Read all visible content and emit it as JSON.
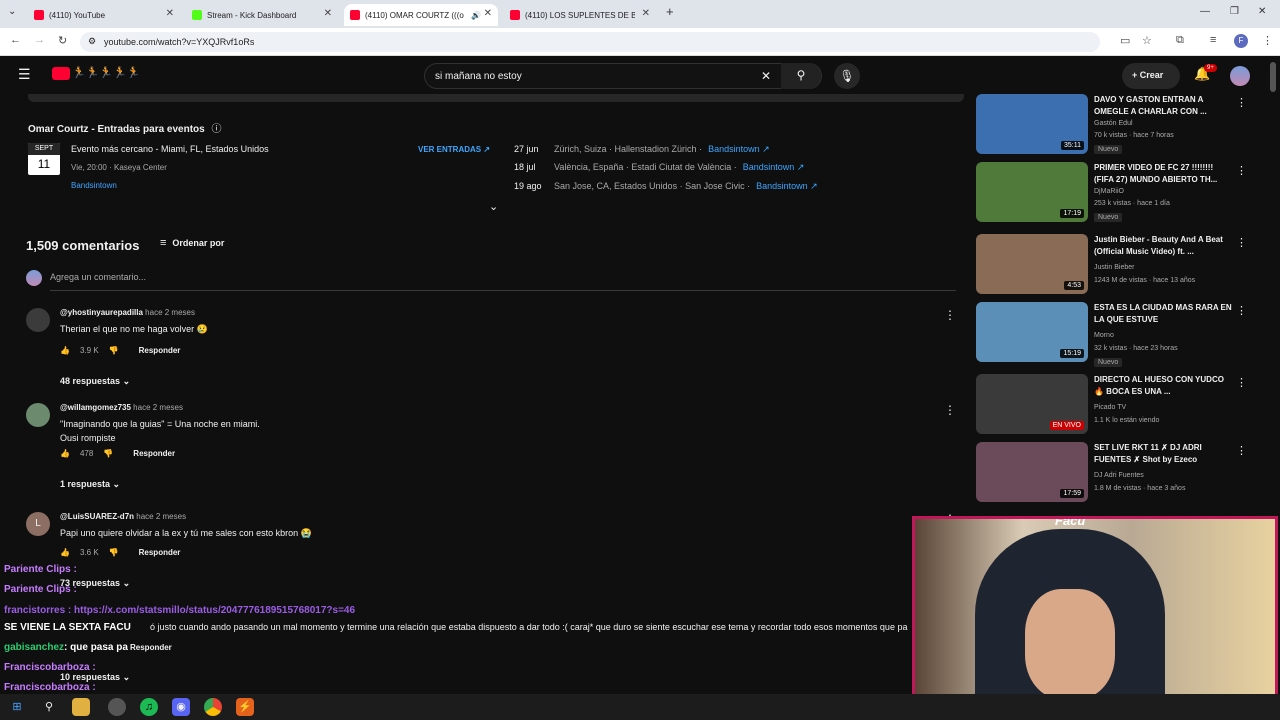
{
  "browser": {
    "tabs": [
      {
        "title": "(4110) YouTube",
        "color": "#ff0033"
      },
      {
        "title": "Stream - Kick Dashboard",
        "color": "#53fc18"
      },
      {
        "title": "(4110) OMAR COURTZ (((o",
        "color": "#ff0033"
      },
      {
        "title": "(4110) LOS SUPLENTES DE BOC",
        "color": "#ff0033"
      }
    ],
    "url": "youtube.com/watch?v=YXQJRvf1oRs"
  },
  "youtube": {
    "search_value": "si mañana no estoy",
    "create_label": "Crear",
    "notif_badge": "9+"
  },
  "events": {
    "title": "Omar Courtz - Entradas para eventos",
    "month": "SEPT",
    "day": "11",
    "headline": "Evento más cercano - Miami, FL, Estados Unidos",
    "time_venue": "Vie, 20:00 · Kaseya Center",
    "provider": "Bandsintown",
    "cta": "VER ENTRADAS ↗",
    "list": [
      {
        "date": "27 jun",
        "place": "Zürich, Suiza · Hallenstadion Zürich ·",
        "link": "Bandsintown ↗"
      },
      {
        "date": "18 jul",
        "place": "València, España · Estadi Ciutat de València ·",
        "link": "Bandsintown ↗"
      },
      {
        "date": "19 ago",
        "place": "San Jose, CA, Estados Unidos · San Jose Civic ·",
        "link": "Bandsintown ↗"
      }
    ]
  },
  "comments_header": {
    "count": "1,509 comentarios",
    "sort": "Ordenar por",
    "add_placeholder": "Agrega un comentario..."
  },
  "comments": [
    {
      "user": "@yhostinyaurepadilla",
      "when": "hace 2 meses",
      "text": "Therian el que no me haga volver 😢",
      "likes": "3.9 K",
      "reply": "Responder",
      "replies": "48 respuestas"
    },
    {
      "user": "@willamgomez735",
      "when": "hace 2 meses",
      "text": "\"Imaginando que la guias\" = Una noche en miami.",
      "text2": "Ousi rompiste",
      "likes": "478",
      "reply": "Responder",
      "replies": "1 respuesta"
    },
    {
      "user": "@LuisSUAREZ-d7n",
      "when": "hace 2 meses",
      "text": "Papi uno quiere olvidar a la ex y tú me sales con esto kbron 😭",
      "likes": "3.6 K",
      "reply": "Responder",
      "replies": "73 respuestas",
      "avatar_letter": "L"
    }
  ],
  "partial": {
    "text": "ó justo cuando ando pasando un mal momento y termine una relación que estaba dispuesto a dar todo :( caraj* que duro se siente escuchar ese tema y recordar todo esos momentos que pa",
    "reply": "Responder",
    "replies": "10 respuestas"
  },
  "recommendations": [
    {
      "title": "DAVO Y GASTON ENTRAN A OMEGLE A CHARLAR CON ...",
      "channel": "Gastón Edul",
      "meta": "70 k vistas · hace 7 horas",
      "badge": "Nuevo",
      "duration": "35:11",
      "color": "#3b6fb0"
    },
    {
      "title": "PRIMER VIDEO DE FC 27 !!!!!!!! (FIFA 27) MUNDO ABIERTO TH...",
      "channel": "DjMaRiiO",
      "meta": "253 k vistas · hace 1 día",
      "badge": "Nuevo",
      "duration": "17:19",
      "color": "#4f7a3a"
    },
    {
      "title": "Justin Bieber - Beauty And A Beat (Official Music Video) ft. ...",
      "channel": "Justin Bieber",
      "meta": "1243 M de vistas · hace 13 años",
      "badge": "",
      "duration": "4:53",
      "color": "#8a6b55"
    },
    {
      "title": "ESTA ES LA CIUDAD MAS RARA EN LA QUE ESTUVE",
      "channel": "Morno",
      "meta": "32 k vistas · hace 23 horas",
      "badge": "Nuevo",
      "duration": "15:19",
      "color": "#5b8fb8"
    },
    {
      "title": "DIRECTO AL HUESO CON YUDCO 🔥 BOCA ES UNA ...",
      "channel": "Picado TV",
      "meta": "1.1 K lo están viendo",
      "badge": "",
      "duration": "EN VIVO",
      "color": "#3a3a3a"
    },
    {
      "title": "SET LIVE RKT 11 ✗ DJ ADRI FUENTES ✗ Shot by Ezeco",
      "channel": "DJ Adri Fuentes",
      "meta": "1.8 M de vistas · hace 3 años",
      "badge": "",
      "duration": "17:59",
      "color": "#6b4a5a"
    }
  ],
  "chat": [
    {
      "user": "Pariente Clips :",
      "msg": "",
      "color": "#c77dff"
    },
    {
      "user": "Pariente Clips :",
      "msg": "",
      "color": "#c77dff"
    },
    {
      "user": "francistorres :",
      "msg": "https://x.com/statsmillo/status/2047776189515768017?s=46",
      "color": "#9b5de5"
    },
    {
      "user": "SE VIENE LA SEXTA FACU",
      "msg": "",
      "color": "#ffffff"
    },
    {
      "user": "gabisanchez",
      "msg": ": que pasa pa",
      "color": "#2ecc71"
    },
    {
      "user": "Franciscobarboza :",
      "msg": "",
      "color": "#c77dff"
    },
    {
      "user": "Franciscobarboza :",
      "msg": "",
      "color": "#c77dff"
    }
  ],
  "webcam": {
    "overlay": "Facu"
  }
}
